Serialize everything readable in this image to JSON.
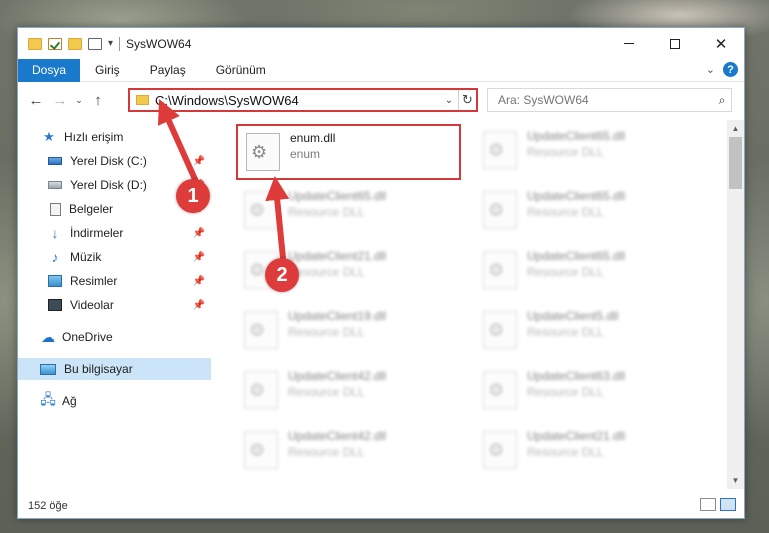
{
  "window": {
    "title": "SysWOW64",
    "controls": {
      "minimize": "minimize-icon",
      "maximize": "maximize-icon",
      "close": "✕"
    }
  },
  "ribbon": {
    "tabs": [
      {
        "label": "Dosya",
        "active": true
      },
      {
        "label": "Giriş"
      },
      {
        "label": "Paylaş"
      },
      {
        "label": "Görünüm"
      }
    ],
    "help": "?",
    "expand": "⌄"
  },
  "navigation": {
    "back": "←",
    "forward": "→",
    "recent": "⌄",
    "up": "↑",
    "address": "C:\\Windows\\SysWOW64",
    "address_dropdown": "⌄",
    "refresh": "↻",
    "search_placeholder": "Ara: SysWOW64",
    "search_icon": "⌕"
  },
  "sidebar": {
    "items": [
      {
        "label": "Hızlı erişim",
        "icon": "star-icon",
        "pinned": false
      },
      {
        "label": "Yerel Disk (C:)",
        "icon": "drive-c-icon",
        "pinned": true
      },
      {
        "label": "Yerel Disk (D:)",
        "icon": "drive-d-icon",
        "pinned": true
      },
      {
        "label": "Belgeler",
        "icon": "documents-icon",
        "pinned": true
      },
      {
        "label": "İndirmeler",
        "icon": "download-icon",
        "pinned": true
      },
      {
        "label": "Müzik",
        "icon": "music-icon",
        "pinned": true
      },
      {
        "label": "Resimler",
        "icon": "pictures-icon",
        "pinned": true
      },
      {
        "label": "Videolar",
        "icon": "videos-icon",
        "pinned": true
      },
      {
        "label": "OneDrive",
        "icon": "cloud-icon",
        "pinned": false
      },
      {
        "label": "Bu bilgisayar",
        "icon": "pc-icon",
        "pinned": false,
        "selected": true
      },
      {
        "label": "Ağ",
        "icon": "network-icon",
        "pinned": false
      }
    ],
    "pin_glyph": "📌"
  },
  "files": [
    {
      "name": "enum.dll",
      "type": "enum",
      "highlighted": true
    },
    {
      "name": "UpdateClient65.dll",
      "type": "Resource DLL"
    },
    {
      "name": "UpdateClient65.dll",
      "type": "Resource DLL"
    },
    {
      "name": "UpdateClient65.dll",
      "type": "Resource DLL"
    },
    {
      "name": "UpdateClient21.dll",
      "type": "Resource DLL"
    },
    {
      "name": "UpdateClient65.dll",
      "type": "Resource DLL"
    },
    {
      "name": "UpdateClient19.dll",
      "type": "Resource DLL"
    },
    {
      "name": "UpdateClient5.dll",
      "type": "Resource DLL"
    },
    {
      "name": "UpdateClient42.dll",
      "type": "Resource DLL"
    },
    {
      "name": "UpdateClient63.dll",
      "type": "Resource DLL"
    },
    {
      "name": "UpdateClient42.dll",
      "type": "Resource DLL"
    },
    {
      "name": "UpdateClient21.dll",
      "type": "Resource DLL"
    }
  ],
  "status": {
    "item_count": "152 öğe"
  },
  "annotations": {
    "marker_1": "1",
    "marker_2": "2",
    "color": "#de3b3b"
  }
}
